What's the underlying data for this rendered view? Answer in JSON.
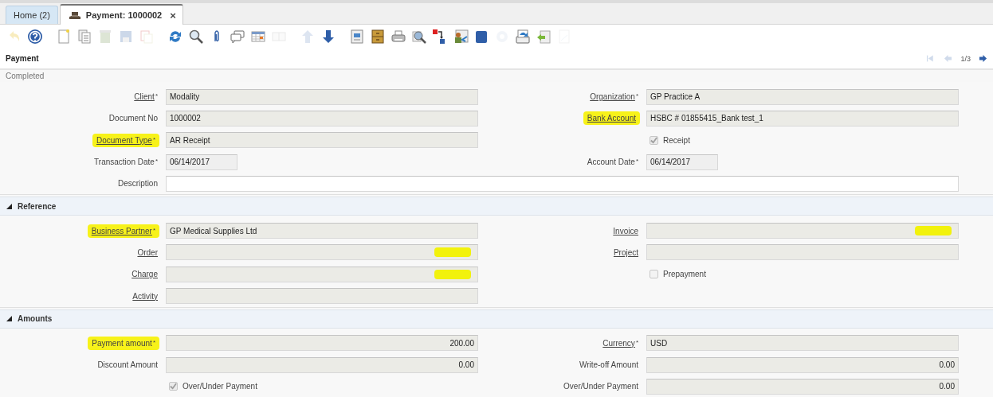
{
  "tabs": [
    {
      "label": "Home (2)",
      "selected": false
    },
    {
      "label": "Payment: 1000002",
      "selected": true,
      "close": "×"
    }
  ],
  "toolbar": [
    [
      {
        "kind": "undo",
        "disabled": true
      },
      {
        "kind": "help",
        "disabled": false
      }
    ],
    [
      {
        "kind": "new",
        "disabled": false
      },
      {
        "kind": "copy",
        "disabled": false
      },
      {
        "kind": "delete",
        "disabled": true
      },
      {
        "kind": "save",
        "disabled": true
      },
      {
        "kind": "copydetail",
        "disabled": true
      }
    ],
    [
      {
        "kind": "refresh",
        "disabled": false
      },
      {
        "kind": "find",
        "disabled": false
      },
      {
        "kind": "attach",
        "disabled": false
      },
      {
        "kind": "chat",
        "disabled": false
      },
      {
        "kind": "grid",
        "disabled": false
      },
      {
        "kind": "split",
        "disabled": true
      }
    ],
    [
      {
        "kind": "up",
        "disabled": true
      },
      {
        "kind": "down",
        "disabled": false
      }
    ],
    [
      {
        "kind": "report",
        "disabled": false
      },
      {
        "kind": "archive",
        "disabled": false
      },
      {
        "kind": "print",
        "disabled": false
      },
      {
        "kind": "zoom",
        "disabled": false
      },
      {
        "kind": "workflow",
        "disabled": false
      },
      {
        "kind": "request",
        "disabled": false
      },
      {
        "kind": "product",
        "disabled": false
      },
      {
        "kind": "process",
        "disabled": true
      },
      {
        "kind": "export",
        "disabled": false
      },
      {
        "kind": "import",
        "disabled": false
      },
      {
        "kind": "blank",
        "disabled": true
      }
    ]
  ],
  "header": {
    "title": "Payment",
    "nav": [
      {
        "kind": "first",
        "disabled": true
      },
      {
        "kind": "prev",
        "disabled": true
      },
      {
        "kind": "counter",
        "text": "1/3"
      },
      {
        "kind": "next",
        "disabled": false
      }
    ]
  },
  "status": "Completed",
  "sections": [
    {
      "rows": [
        {
          "left": {
            "kind": "text",
            "label": "Client",
            "link": true,
            "required": "*",
            "highlighted": false,
            "value": "Modality",
            "readonly": true
          },
          "right": {
            "kind": "text",
            "label": "Organization",
            "link": true,
            "required": "*",
            "highlighted": false,
            "value": "GP Practice A",
            "readonly": true
          }
        },
        {
          "left": {
            "kind": "text",
            "label": "Document No",
            "link": false,
            "highlighted": false,
            "value": "1000002",
            "readonly": true
          },
          "right": {
            "kind": "text",
            "label": "Bank Account",
            "link": true,
            "highlighted": true,
            "value": "HSBC # 01855415_Bank test_1",
            "readonly": true
          }
        },
        {
          "left": {
            "kind": "text",
            "label": "Document Type",
            "link": true,
            "required": "*",
            "highlighted": true,
            "value": "AR Receipt",
            "readonly": true
          },
          "right": {
            "kind": "checkbox",
            "label": "Receipt",
            "checked": true,
            "disabled": true
          }
        },
        {
          "left": {
            "kind": "date",
            "label": "Transaction Date",
            "link": false,
            "required": "*",
            "highlighted": false,
            "value": "06/14/2017",
            "readonly": true
          },
          "right": {
            "kind": "date",
            "label": "Account Date",
            "link": false,
            "required": "*",
            "highlighted": false,
            "value": "06/14/2017",
            "readonly": true
          }
        },
        {
          "left": {
            "kind": "wide",
            "label": "Description",
            "link": false,
            "highlighted": false,
            "readonly": false
          }
        }
      ]
    },
    {
      "title": "Reference",
      "expanded": true,
      "rows": [
        {
          "left": {
            "kind": "text",
            "label": "Business Partner",
            "link": true,
            "required": "*",
            "highlighted": true,
            "value": "GP Medical Supplies Ltd",
            "readonly": true
          },
          "right": {
            "kind": "text",
            "label": "Invoice",
            "link": true,
            "highlighted": false,
            "readonly": true,
            "marked": true
          }
        },
        {
          "left": {
            "kind": "text",
            "label": "Order",
            "link": true,
            "highlighted": false,
            "readonly": true,
            "marked": true
          },
          "right": {
            "kind": "text",
            "label": "Project",
            "link": true,
            "highlighted": false,
            "readonly": true
          }
        },
        {
          "left": {
            "kind": "text",
            "label": "Charge",
            "link": true,
            "highlighted": false,
            "readonly": true,
            "marked": true
          },
          "right": {
            "kind": "checkbox",
            "label": "Prepayment",
            "checked": false,
            "disabled": true
          }
        },
        {
          "left": {
            "kind": "text",
            "label": "Activity",
            "link": true,
            "highlighted": false,
            "readonly": true
          }
        }
      ]
    },
    {
      "title": "Amounts",
      "expanded": true,
      "rows": [
        {
          "left": {
            "kind": "number",
            "label": "Payment amount",
            "link": false,
            "required": "*",
            "highlighted": true,
            "value": "200.00",
            "readonly": true
          },
          "right": {
            "kind": "text",
            "label": "Currency",
            "link": true,
            "required": "*",
            "highlighted": false,
            "value": "USD",
            "readonly": true
          }
        },
        {
          "left": {
            "kind": "number",
            "label": "Discount Amount",
            "link": false,
            "highlighted": false,
            "value": "0.00",
            "readonly": true
          },
          "right": {
            "kind": "number",
            "label": "Write-off Amount",
            "link": false,
            "highlighted": false,
            "value": "0.00",
            "readonly": true
          }
        },
        {
          "left": {
            "kind": "checkbox",
            "label": "Over/Under Payment",
            "checked": true,
            "disabled": true
          },
          "right": {
            "kind": "number",
            "label": "Over/Under Payment",
            "link": false,
            "highlighted": false,
            "value": "0.00",
            "readonly": true
          }
        }
      ]
    }
  ]
}
